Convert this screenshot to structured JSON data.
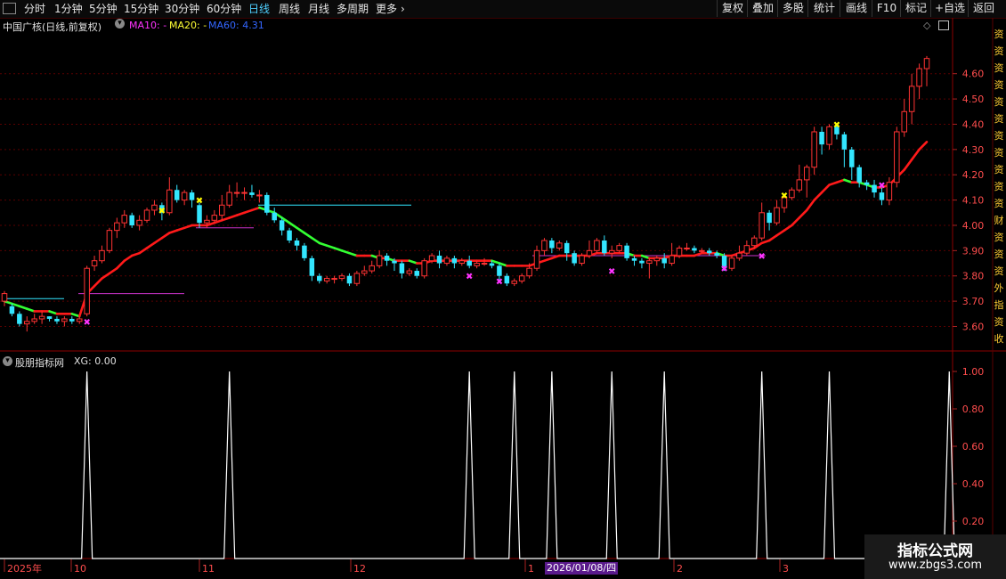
{
  "toolbar": {
    "icon": "panel-icon",
    "periods": [
      "分时",
      "1分钟",
      "5分钟",
      "15分钟",
      "30分钟",
      "60分钟",
      "日线",
      "周线",
      "月线",
      "多周期",
      "更多"
    ],
    "active_period": "日线",
    "more_arrow": "›",
    "right_buttons": [
      "复权",
      "叠加",
      "多股",
      "统计",
      "画线",
      "F10",
      "标记",
      "+自选",
      "返回"
    ]
  },
  "main_panel": {
    "stock_title": "中国广核(日线,前复权)",
    "ma10_label": "MA10: -",
    "ma20_label": "MA20: -",
    "ma60_label": "MA60: 4.31",
    "colors": {
      "ma10": "#ff33ff",
      "ma20": "#ffff00",
      "ma60": "#3366ff",
      "up": "#ff3333",
      "down": "#33e6ff",
      "ma_up": "#ff1a1a",
      "ma_down": "#33ff33"
    },
    "price_axis": [
      "4.60",
      "4.50",
      "4.40",
      "4.30",
      "4.20",
      "4.10",
      "4.00",
      "3.90",
      "3.80",
      "3.70",
      "3.60"
    ]
  },
  "indicator_panel": {
    "title": "股朋指标网",
    "xg_label": "XG: 0.00",
    "axis": [
      "1.00",
      "0.80",
      "0.60",
      "0.40",
      "0.20"
    ]
  },
  "date_axis": {
    "labels": [
      "2025年",
      "10",
      "11",
      "12",
      "1",
      "2",
      "3"
    ],
    "cursor_date": "2026/01/08/四"
  },
  "right_side_strip": [
    "资",
    "资",
    "资",
    "资",
    "资",
    "资",
    "资",
    "资",
    "资",
    "资",
    "资",
    "财",
    "资",
    "资",
    "资",
    "外",
    "指",
    "资",
    "收"
  ],
  "watermark": {
    "line1": "指标公式网",
    "line2": "www.zbgs3.com"
  },
  "chart_data": {
    "type": "candlestick",
    "ylim": [
      3.57,
      4.68
    ],
    "candles": [
      [
        3.7,
        3.73,
        3.68,
        3.74
      ],
      [
        3.68,
        3.65,
        3.64,
        3.69
      ],
      [
        3.65,
        3.61,
        3.6,
        3.66
      ],
      [
        3.61,
        3.62,
        3.58,
        3.64
      ],
      [
        3.62,
        3.63,
        3.61,
        3.65
      ],
      [
        3.63,
        3.64,
        3.61,
        3.66
      ],
      [
        3.64,
        3.63,
        3.62,
        3.64
      ],
      [
        3.63,
        3.62,
        3.61,
        3.64
      ],
      [
        3.62,
        3.63,
        3.6,
        3.64
      ],
      [
        3.63,
        3.62,
        3.61,
        3.64
      ],
      [
        3.62,
        3.63,
        3.61,
        3.64
      ],
      [
        3.65,
        3.83,
        3.64,
        3.84
      ],
      [
        3.84,
        3.86,
        3.82,
        3.88
      ],
      [
        3.86,
        3.9,
        3.85,
        3.92
      ],
      [
        3.9,
        3.98,
        3.89,
        3.99
      ],
      [
        3.98,
        4.01,
        3.95,
        4.03
      ],
      [
        4.01,
        4.04,
        3.99,
        4.06
      ],
      [
        4.04,
        4.0,
        3.99,
        4.05
      ],
      [
        4.0,
        4.02,
        3.98,
        4.04
      ],
      [
        4.02,
        4.06,
        4.01,
        4.07
      ],
      [
        4.06,
        4.08,
        4.04,
        4.1
      ],
      [
        4.08,
        4.05,
        4.02,
        4.09
      ],
      [
        4.05,
        4.14,
        4.04,
        4.19
      ],
      [
        4.14,
        4.1,
        4.09,
        4.16
      ],
      [
        4.1,
        4.13,
        4.08,
        4.14
      ],
      [
        4.13,
        4.1,
        4.07,
        4.14
      ],
      [
        4.08,
        4.01,
        3.99,
        4.09
      ],
      [
        4.01,
        4.02,
        3.99,
        4.04
      ],
      [
        4.02,
        4.04,
        4.01,
        4.06
      ],
      [
        4.04,
        4.08,
        4.02,
        4.12
      ],
      [
        4.08,
        4.13,
        4.07,
        4.16
      ],
      [
        4.13,
        4.13,
        4.11,
        4.17
      ],
      [
        4.13,
        4.13,
        4.1,
        4.15
      ],
      [
        4.13,
        4.12,
        4.11,
        4.16
      ],
      [
        4.12,
        4.12,
        4.09,
        4.14
      ],
      [
        4.12,
        4.05,
        4.04,
        4.13
      ],
      [
        4.05,
        4.02,
        4.01,
        4.07
      ],
      [
        4.02,
        3.98,
        3.96,
        4.03
      ],
      [
        3.98,
        3.94,
        3.93,
        3.99
      ],
      [
        3.94,
        3.92,
        3.9,
        3.95
      ],
      [
        3.92,
        3.87,
        3.86,
        3.93
      ],
      [
        3.87,
        3.8,
        3.78,
        3.88
      ],
      [
        3.8,
        3.78,
        3.77,
        3.81
      ],
      [
        3.78,
        3.79,
        3.77,
        3.8
      ],
      [
        3.79,
        3.79,
        3.77,
        3.8
      ],
      [
        3.79,
        3.8,
        3.78,
        3.81
      ],
      [
        3.8,
        3.77,
        3.76,
        3.81
      ],
      [
        3.77,
        3.81,
        3.76,
        3.82
      ],
      [
        3.81,
        3.82,
        3.8,
        3.84
      ],
      [
        3.82,
        3.84,
        3.81,
        3.86
      ],
      [
        3.84,
        3.88,
        3.83,
        3.9
      ],
      [
        3.88,
        3.86,
        3.84,
        3.89
      ],
      [
        3.86,
        3.85,
        3.82,
        3.87
      ],
      [
        3.85,
        3.81,
        3.79,
        3.86
      ],
      [
        3.81,
        3.82,
        3.8,
        3.83
      ],
      [
        3.82,
        3.8,
        3.79,
        3.83
      ],
      [
        3.8,
        3.86,
        3.79,
        3.87
      ],
      [
        3.86,
        3.88,
        3.85,
        3.89
      ],
      [
        3.88,
        3.85,
        3.83,
        3.9
      ],
      [
        3.85,
        3.87,
        3.84,
        3.88
      ],
      [
        3.87,
        3.85,
        3.83,
        3.88
      ],
      [
        3.85,
        3.86,
        3.84,
        3.87
      ],
      [
        3.86,
        3.84,
        3.83,
        3.88
      ],
      [
        3.84,
        3.85,
        3.83,
        3.86
      ],
      [
        3.85,
        3.85,
        3.84,
        3.87
      ],
      [
        3.85,
        3.84,
        3.83,
        3.86
      ],
      [
        3.84,
        3.8,
        3.78,
        3.85
      ],
      [
        3.8,
        3.77,
        3.76,
        3.81
      ],
      [
        3.77,
        3.78,
        3.76,
        3.79
      ],
      [
        3.78,
        3.8,
        3.77,
        3.81
      ],
      [
        3.8,
        3.83,
        3.79,
        3.85
      ],
      [
        3.83,
        3.9,
        3.82,
        3.92
      ],
      [
        3.9,
        3.94,
        3.88,
        3.95
      ],
      [
        3.94,
        3.91,
        3.89,
        3.95
      ],
      [
        3.91,
        3.93,
        3.9,
        3.94
      ],
      [
        3.93,
        3.89,
        3.86,
        3.94
      ],
      [
        3.89,
        3.85,
        3.84,
        3.9
      ],
      [
        3.85,
        3.88,
        3.84,
        3.89
      ],
      [
        3.88,
        3.9,
        3.87,
        3.94
      ],
      [
        3.9,
        3.94,
        3.89,
        3.95
      ],
      [
        3.94,
        3.89,
        3.88,
        3.96
      ],
      [
        3.89,
        3.9,
        3.87,
        3.92
      ],
      [
        3.9,
        3.92,
        3.89,
        3.93
      ],
      [
        3.92,
        3.87,
        3.86,
        3.93
      ],
      [
        3.87,
        3.86,
        3.84,
        3.88
      ],
      [
        3.86,
        3.85,
        3.83,
        3.87
      ],
      [
        3.85,
        3.86,
        3.79,
        3.87
      ],
      [
        3.86,
        3.87,
        3.84,
        3.88
      ],
      [
        3.87,
        3.85,
        3.83,
        3.89
      ],
      [
        3.85,
        3.88,
        3.84,
        3.93
      ],
      [
        3.88,
        3.91,
        3.87,
        3.92
      ],
      [
        3.91,
        3.91,
        3.9,
        3.93
      ],
      [
        3.91,
        3.9,
        3.89,
        3.92
      ],
      [
        3.9,
        3.9,
        3.89,
        3.91
      ],
      [
        3.9,
        3.89,
        3.88,
        3.91
      ],
      [
        3.89,
        3.88,
        3.87,
        3.9
      ],
      [
        3.88,
        3.83,
        3.82,
        3.89
      ],
      [
        3.83,
        3.87,
        3.82,
        3.88
      ],
      [
        3.87,
        3.89,
        3.86,
        3.92
      ],
      [
        3.89,
        3.92,
        3.88,
        3.94
      ],
      [
        3.92,
        3.95,
        3.91,
        3.96
      ],
      [
        3.95,
        4.05,
        3.94,
        4.09
      ],
      [
        4.05,
        4.01,
        3.98,
        4.06
      ],
      [
        4.01,
        4.07,
        4.0,
        4.1
      ],
      [
        4.07,
        4.11,
        4.05,
        4.12
      ],
      [
        4.11,
        4.14,
        4.1,
        4.15
      ],
      [
        4.14,
        4.18,
        4.13,
        4.24
      ],
      [
        4.18,
        4.23,
        4.11,
        4.24
      ],
      [
        4.23,
        4.37,
        4.2,
        4.39
      ],
      [
        4.37,
        4.32,
        4.28,
        4.39
      ],
      [
        4.32,
        4.39,
        4.3,
        4.4
      ],
      [
        4.39,
        4.36,
        4.34,
        4.4
      ],
      [
        4.36,
        4.3,
        4.23,
        4.37
      ],
      [
        4.3,
        4.23,
        4.18,
        4.31
      ],
      [
        4.23,
        4.17,
        4.15,
        4.24
      ],
      [
        4.17,
        4.16,
        4.14,
        4.18
      ],
      [
        4.16,
        4.13,
        4.11,
        4.18
      ],
      [
        4.13,
        4.1,
        4.08,
        4.15
      ],
      [
        4.1,
        4.17,
        4.08,
        4.19
      ],
      [
        4.17,
        4.37,
        4.15,
        4.39
      ],
      [
        4.37,
        4.45,
        4.35,
        4.5
      ],
      [
        4.45,
        4.55,
        4.4,
        4.6
      ],
      [
        4.55,
        4.62,
        4.5,
        4.64
      ],
      [
        4.62,
        4.66,
        4.55,
        4.67
      ]
    ],
    "ma_line": [
      3.7,
      3.69,
      3.68,
      3.67,
      3.66,
      3.66,
      3.66,
      3.65,
      3.65,
      3.65,
      3.64,
      3.73,
      3.76,
      3.79,
      3.81,
      3.83,
      3.86,
      3.88,
      3.89,
      3.91,
      3.93,
      3.95,
      3.97,
      3.98,
      3.99,
      4.0,
      4.0,
      4.0,
      4.01,
      4.02,
      4.03,
      4.04,
      4.05,
      4.06,
      4.07,
      4.06,
      4.05,
      4.03,
      4.01,
      3.99,
      3.97,
      3.95,
      3.93,
      3.92,
      3.91,
      3.9,
      3.89,
      3.88,
      3.88,
      3.88,
      3.87,
      3.87,
      3.86,
      3.86,
      3.86,
      3.85,
      3.85,
      3.86,
      3.86,
      3.86,
      3.86,
      3.86,
      3.86,
      3.86,
      3.86,
      3.86,
      3.85,
      3.84,
      3.84,
      3.84,
      3.84,
      3.85,
      3.86,
      3.87,
      3.88,
      3.88,
      3.88,
      3.88,
      3.88,
      3.89,
      3.89,
      3.89,
      3.89,
      3.89,
      3.88,
      3.88,
      3.87,
      3.87,
      3.87,
      3.88,
      3.88,
      3.88,
      3.88,
      3.89,
      3.89,
      3.89,
      3.88,
      3.88,
      3.89,
      3.9,
      3.91,
      3.93,
      3.94,
      3.96,
      3.98,
      4.0,
      4.03,
      4.06,
      4.1,
      4.13,
      4.16,
      4.17,
      4.18,
      4.17,
      4.17,
      4.16,
      4.15,
      4.15,
      4.16,
      4.19,
      4.22,
      4.26,
      4.3,
      4.33
    ],
    "xg_signal_bars": [
      11,
      30,
      62,
      68,
      73,
      81,
      88,
      101,
      110,
      126
    ]
  }
}
